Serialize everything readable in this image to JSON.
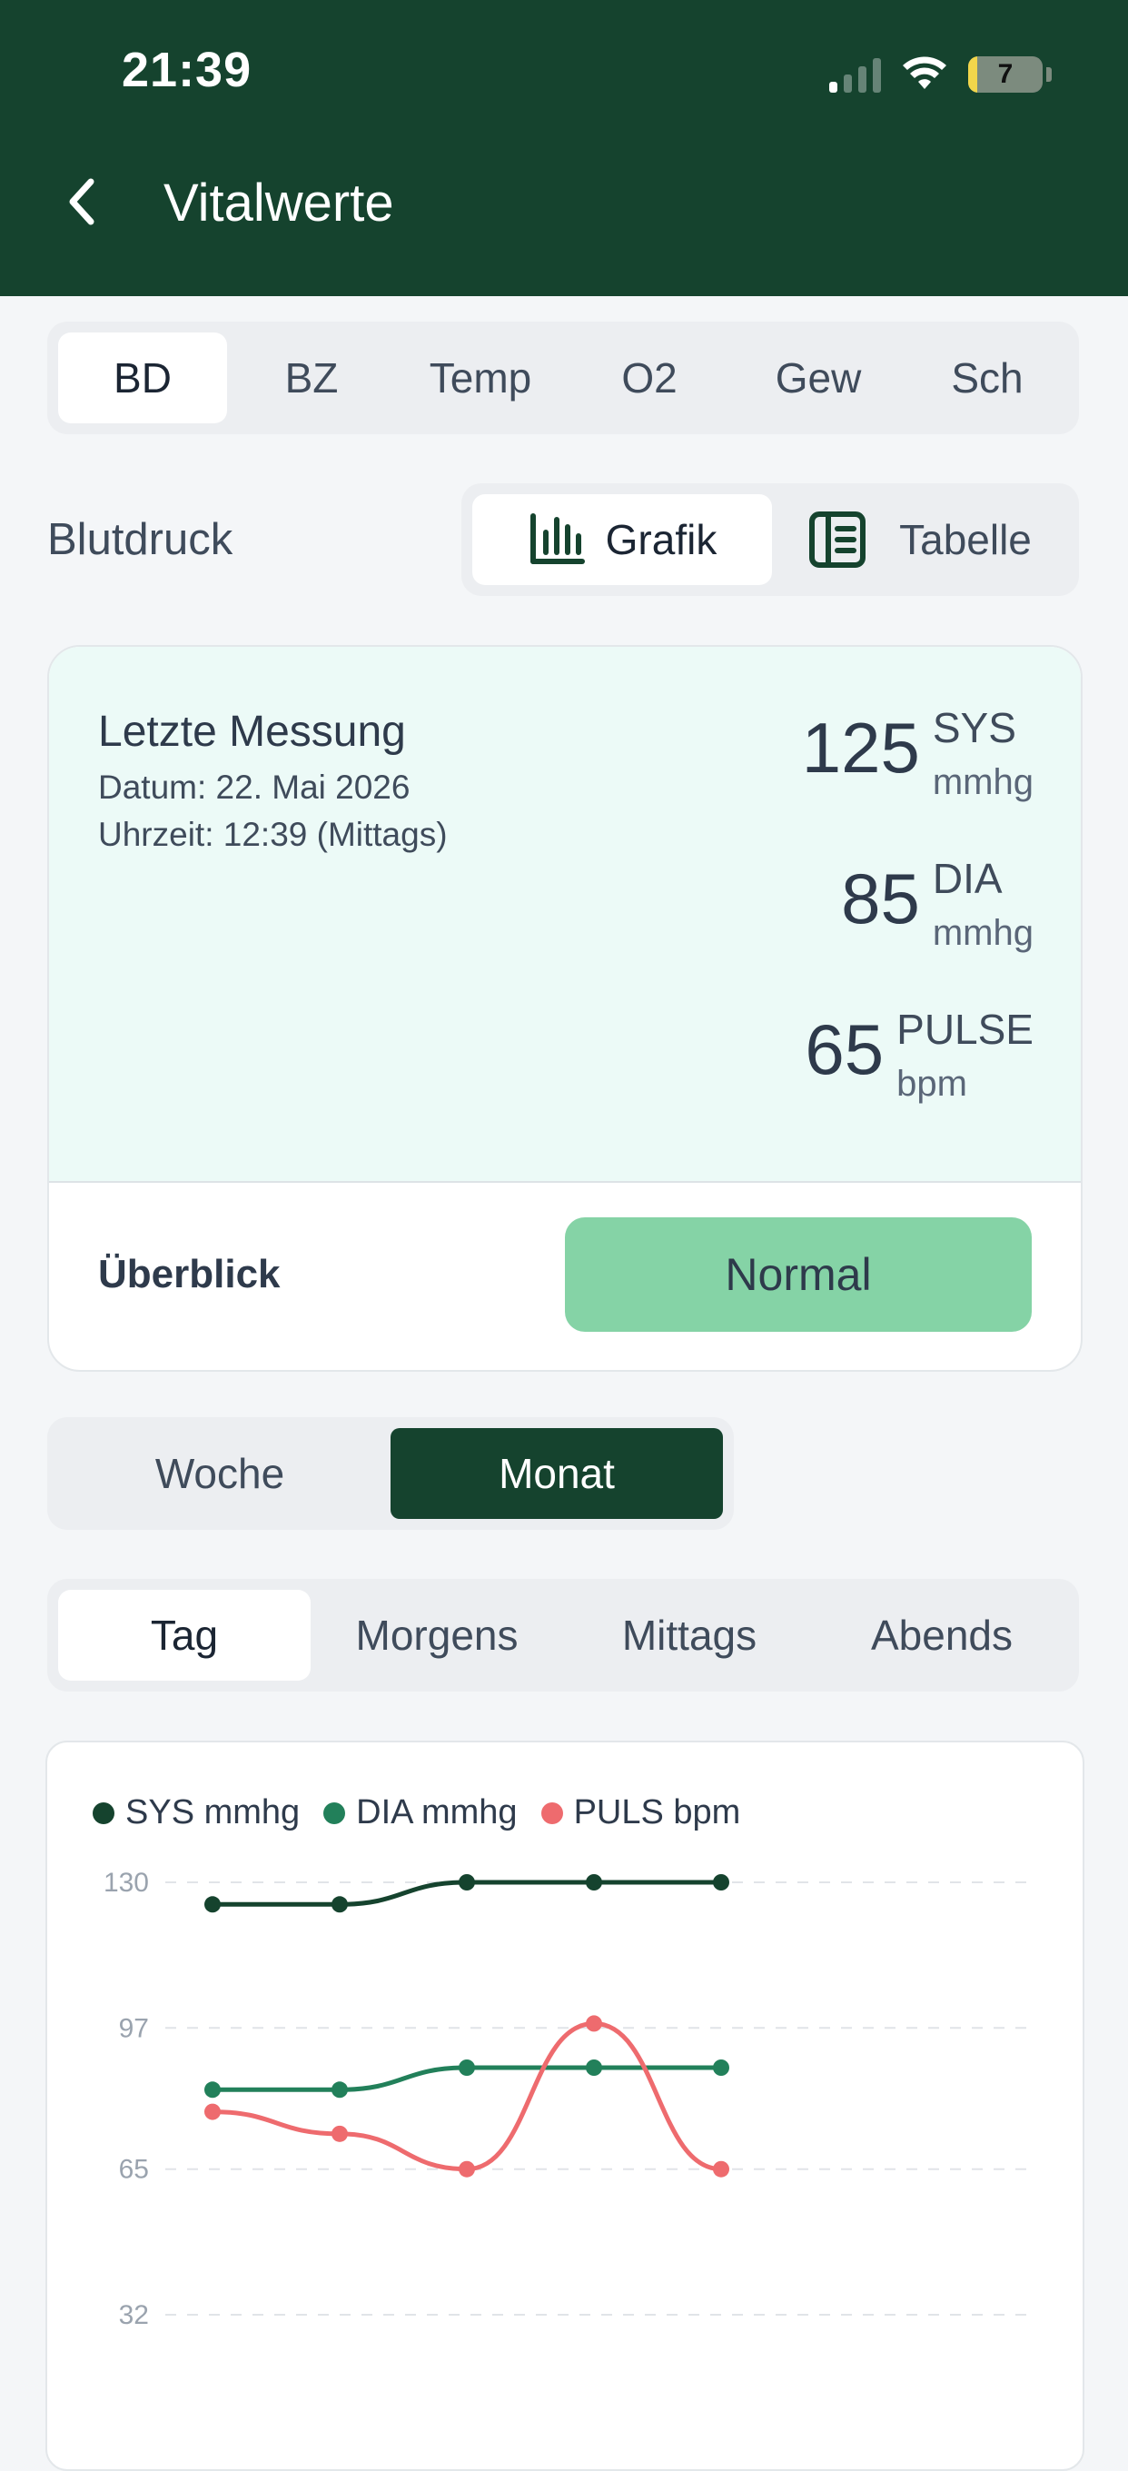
{
  "status_bar": {
    "time": "21:39",
    "battery": "7"
  },
  "header": {
    "title": "Vitalwerte",
    "back_icon": "chevron-left-icon"
  },
  "vital_tabs": [
    "BD",
    "BZ",
    "Temp",
    "O2",
    "Gew",
    "Sch"
  ],
  "vital_tabs_active": "BD",
  "section": {
    "title": "Blutdruck",
    "view_toggle": {
      "chart_label": "Grafik",
      "table_label": "Tabelle",
      "active": "Grafik"
    }
  },
  "last_measurement": {
    "title": "Letzte Messung",
    "date": "Datum: 22. Mai 2026",
    "time": "Uhrzeit: 12:39 (Mittags)",
    "readings": [
      {
        "value": "125",
        "label": "SYS",
        "unit": "mmhg"
      },
      {
        "value": "85",
        "label": "DIA",
        "unit": "mmhg"
      },
      {
        "value": "65",
        "label": "PULSE",
        "unit": "bpm"
      }
    ]
  },
  "overview": {
    "label": "Überblick",
    "status": "Normal",
    "status_color": "#85D3A6"
  },
  "period_toggle": {
    "week": "Woche",
    "month": "Monat",
    "active": "Monat"
  },
  "time_of_day_tabs": [
    "Tag",
    "Morgens",
    "Mittags",
    "Abends"
  ],
  "time_of_day_active": "Tag",
  "colors": {
    "header": "#15432E",
    "sys": "#15432E",
    "dia": "#22805A",
    "puls": "#EE6B6E"
  },
  "chart_data": {
    "type": "line",
    "legend": [
      "SYS mmhg",
      "DIA mmhg",
      "PULS bpm"
    ],
    "y_ticks": [
      130,
      97,
      65,
      32
    ],
    "ylim": [
      32,
      130
    ],
    "grid": true,
    "legend_position": "top-left",
    "x": [
      1,
      2,
      3,
      4,
      5
    ],
    "series": [
      {
        "name": "SYS mmhg",
        "values": [
          125,
          125,
          130,
          130,
          130
        ]
      },
      {
        "name": "DIA mmhg",
        "values": [
          83,
          83,
          88,
          88,
          88
        ]
      },
      {
        "name": "PULS bpm",
        "values": [
          78,
          73,
          65,
          98,
          65
        ]
      }
    ]
  }
}
